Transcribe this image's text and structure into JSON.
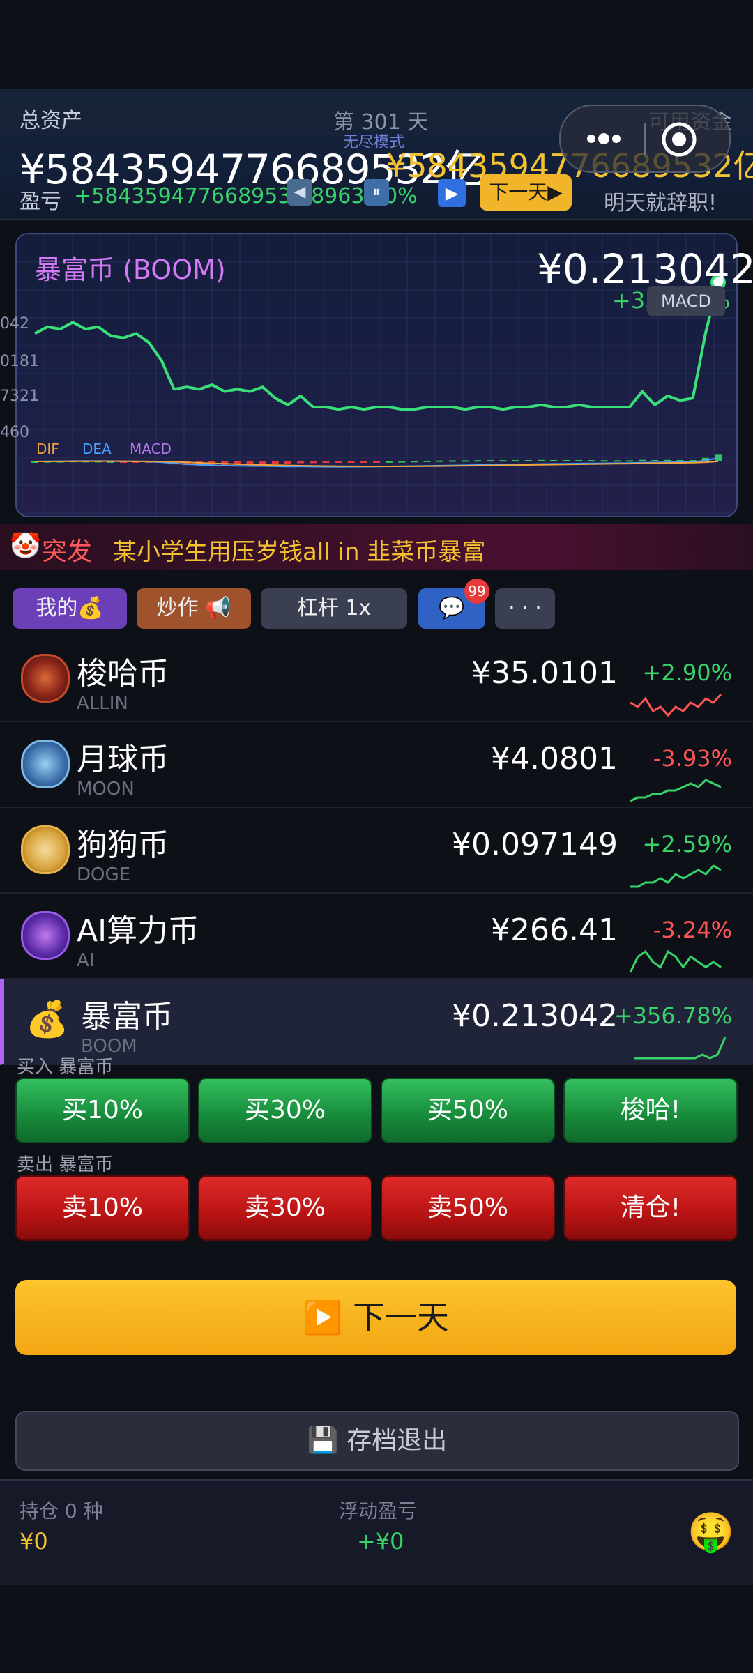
{
  "header": {
    "total_label": "总资产",
    "total_value": "¥5843594776689532亿",
    "day": "第 301 天",
    "mode": "无尽模式",
    "cash_label": "可用资金",
    "cash_value": "¥5843594776689532亿",
    "pnl_label": "盈亏",
    "pnl_value": "+5843594776689532 8963 00%",
    "prev_icon": "◀",
    "pause_icon": "⏸",
    "play_icon": "▶",
    "next_day_btn": "下一天▶",
    "slogan": "明天就辞职!"
  },
  "chart_card": {
    "title": "暴富币 (BOOM)",
    "price": "¥0.213042",
    "change": "+356.78%",
    "macd_toggle": "MACD",
    "y_ticks": [
      "042",
      "0181",
      "7321",
      "460"
    ],
    "macd_labels": [
      "DIF",
      "DEA",
      "MACD"
    ]
  },
  "chart_data": {
    "type": "line",
    "title": "暴富币 (BOOM)",
    "series": [
      {
        "values": [
          0.118,
          0.121,
          0.12,
          0.123,
          0.12,
          0.121,
          0.117,
          0.116,
          0.118,
          0.114,
          0.106,
          0.093,
          0.094,
          0.093,
          0.095,
          0.092,
          0.093,
          0.092,
          0.094,
          0.089,
          0.086,
          0.09,
          0.085,
          0.085,
          0.084,
          0.085,
          0.084,
          0.085,
          0.085,
          0.084,
          0.084,
          0.085,
          0.085,
          0.085,
          0.084,
          0.085,
          0.085,
          0.084,
          0.085,
          0.085,
          0.086,
          0.085,
          0.085,
          0.086,
          0.085,
          0.085,
          0.085,
          0.085,
          0.092,
          0.086,
          0.09,
          0.088,
          0.089,
          0.118,
          0.141
        ]
      }
    ]
  },
  "news": {
    "icon": "🤡",
    "tag": "突发",
    "text": "某小学生用压岁钱all in 韭菜币暴富"
  },
  "tabs": {
    "mine": "我的💰",
    "hype": "炒作 📢",
    "leverage": "杠杆 1x",
    "chat_icon": "💬",
    "chat_badge": "99",
    "more": "· · ·"
  },
  "coins": [
    {
      "name": "梭哈币",
      "symbol": "ALLIN",
      "price": "¥35.0101",
      "change": "+2.90%",
      "spark": [
        5,
        4,
        6,
        3,
        4,
        2,
        4,
        3,
        5,
        4,
        6,
        5,
        7
      ],
      "icon": "poker-chip-icon"
    },
    {
      "name": "月球币",
      "symbol": "MOON",
      "price": "¥4.0801",
      "change": "-3.93%",
      "spark": [
        2,
        3,
        3,
        4,
        4,
        5,
        5,
        6,
        7,
        6,
        8,
        7,
        6
      ],
      "icon": "moon-icon"
    },
    {
      "name": "狗狗币",
      "symbol": "DOGE",
      "price": "¥0.097149",
      "change": "+2.59%",
      "spark": [
        2,
        2,
        3,
        3,
        4,
        3,
        5,
        4,
        5,
        6,
        5,
        7,
        6
      ],
      "icon": "doge-icon"
    },
    {
      "name": "AI算力币",
      "symbol": "AI",
      "price": "¥266.41",
      "change": "-3.24%",
      "spark": [
        3,
        6,
        7,
        5,
        4,
        7,
        6,
        4,
        6,
        5,
        4,
        5,
        4
      ],
      "icon": "ai-chip-icon"
    },
    {
      "name": "暴富币",
      "symbol": "BOOM",
      "price": "¥0.213042",
      "change": "+356.78%",
      "spark": [
        2,
        2,
        2,
        2,
        2,
        2,
        2,
        2,
        2,
        3,
        2,
        3,
        8
      ],
      "icon": "money-bag-icon"
    }
  ],
  "trade": {
    "buy_label": "买入 暴富币",
    "buy_buttons": [
      "买10%",
      "买30%",
      "买50%",
      "梭哈!"
    ],
    "sell_label": "卖出 暴富币",
    "sell_buttons": [
      "卖10%",
      "卖30%",
      "卖50%",
      "清仓!"
    ],
    "next_day": "▶️ 下一天",
    "save_exit": "💾 存档退出"
  },
  "footer": {
    "holding_label": "持仓 0 种",
    "holding_value": "¥0",
    "float_label": "浮动盈亏",
    "float_value": "+¥0",
    "face_icon": "🤑"
  },
  "colors": {
    "up": "#38d26a",
    "down": "#ff5454",
    "gold": "#f4c230",
    "accent_purple": "#b163f2"
  }
}
